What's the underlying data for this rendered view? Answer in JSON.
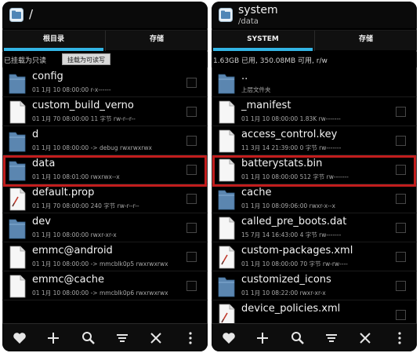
{
  "left": {
    "title": "/",
    "tabs": [
      "根目录",
      "存储"
    ],
    "active_tab": 0,
    "mount_status": "已挂载为只读",
    "mount_button": "挂载为可读写",
    "files": [
      {
        "name": "config",
        "meta": "01 1月 10 08:00:00   r-x------",
        "type": "folder"
      },
      {
        "name": "custom_build_verno",
        "meta": "01 1月 70 08:00:00  11 字节   rw-r--r--",
        "type": "file"
      },
      {
        "name": "d",
        "meta": "01 1月 10 08:00:00  -> debug  rwxrwxrwx",
        "type": "folder"
      },
      {
        "name": "data",
        "meta": "01 1月 10 08:01:00    rwxrwx--x",
        "type": "folder"
      },
      {
        "name": "default.prop",
        "meta": "01 1月 70 08:00:00  240 字节  rw-r--r--",
        "type": "doc"
      },
      {
        "name": "dev",
        "meta": "01 1月 10 08:00:00    rwxr-xr-x",
        "type": "folder"
      },
      {
        "name": "emmc@android",
        "meta": "01 1月 10 08:00:00  -> mmcblk0p5  rwxrwxrwx",
        "type": "file"
      },
      {
        "name": "emmc@cache",
        "meta": "01 1月 10 08:00:00  -> mmcblk0p6  rwxrwxrwx",
        "type": "file"
      }
    ],
    "highlight_index": 3
  },
  "right": {
    "title": "system",
    "subtitle": "/data",
    "tabs": [
      "SYSTEM",
      "存储"
    ],
    "active_tab": 0,
    "storage_info": "1.63GB 已用, 350.08MB 可用, r/w",
    "files": [
      {
        "name": "..",
        "meta": "上层文件夹",
        "type": "folder"
      },
      {
        "name": "_manifest",
        "meta": "01 1月 10 08:00:00  1.83K  rw-------",
        "type": "file"
      },
      {
        "name": "access_control.key",
        "meta": "11 3月 14 21:39:00  0 字节  rw-------",
        "type": "file"
      },
      {
        "name": "batterystats.bin",
        "meta": "01 1月 10 08:00:00  512 字节  rw-------",
        "type": "file"
      },
      {
        "name": "cache",
        "meta": "01 1月 10 08:09:06:00    rwxr-x--x",
        "type": "folder"
      },
      {
        "name": "called_pre_boots.dat",
        "meta": "15 7月 14 16:43:00  4 字节  rw-------",
        "type": "file"
      },
      {
        "name": "custom-packages.xml",
        "meta": "01 1月 10 08:00:00  70 字节  rw-rw----",
        "type": "doc"
      },
      {
        "name": "customized_icons",
        "meta": "01 1月 10 08:22:00    rwxr-xr-x",
        "type": "folder"
      },
      {
        "name": "device_policies.xml",
        "meta": "",
        "type": "doc"
      }
    ],
    "highlight_index": 3
  },
  "bottom_icons": [
    "heart-icon",
    "plus-icon",
    "search-icon",
    "sort-icon",
    "close-icon",
    "more-icon"
  ],
  "colors": {
    "accent": "#33b5e5",
    "highlight": "#c21d1d",
    "folder": "#5b86b0",
    "background": "#000000"
  }
}
